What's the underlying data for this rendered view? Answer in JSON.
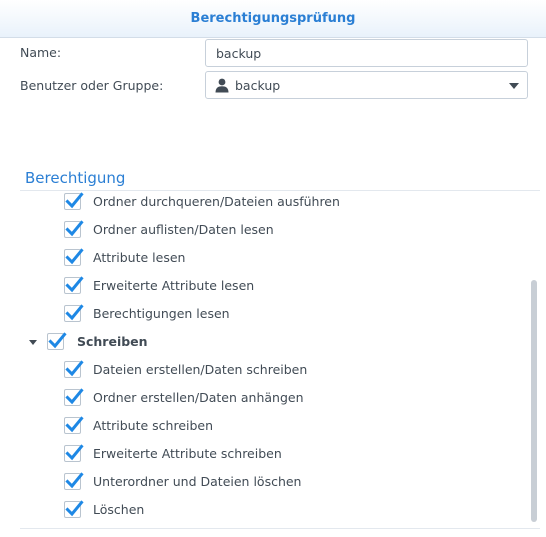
{
  "dialog": {
    "title": "Berechtigungsprüfung"
  },
  "form": {
    "name_label": "Name:",
    "name_value": "backup",
    "user_group_label": "Benutzer oder Gruppe:",
    "user_group_value": "backup"
  },
  "permissions": {
    "section_title": "Berechtigung",
    "read_items": [
      {
        "label": "Ordner durchqueren/Dateien ausführen",
        "checked": true
      },
      {
        "label": "Ordner auflisten/Daten lesen",
        "checked": true
      },
      {
        "label": "Attribute lesen",
        "checked": true
      },
      {
        "label": "Erweiterte Attribute lesen",
        "checked": true
      },
      {
        "label": "Berechtigungen lesen",
        "checked": true
      }
    ],
    "write_group": {
      "label": "Schreiben",
      "checked": true,
      "expanded": true
    },
    "write_items": [
      {
        "label": "Dateien erstellen/Daten schreiben",
        "checked": true
      },
      {
        "label": "Ordner erstellen/Daten anhängen",
        "checked": true
      },
      {
        "label": "Attribute schreiben",
        "checked": true
      },
      {
        "label": "Erweiterte Attribute schreiben",
        "checked": true
      },
      {
        "label": "Unterordner und Dateien löschen",
        "checked": true
      },
      {
        "label": "Löschen",
        "checked": true
      }
    ]
  },
  "colors": {
    "accent": "#2b7fd4",
    "check": "#1e88e5",
    "text": "#414b55"
  },
  "icons": {
    "user": "user-icon",
    "dropdown": "chevron-down-icon",
    "expander": "triangle-down-icon",
    "check": "checkmark-icon"
  }
}
